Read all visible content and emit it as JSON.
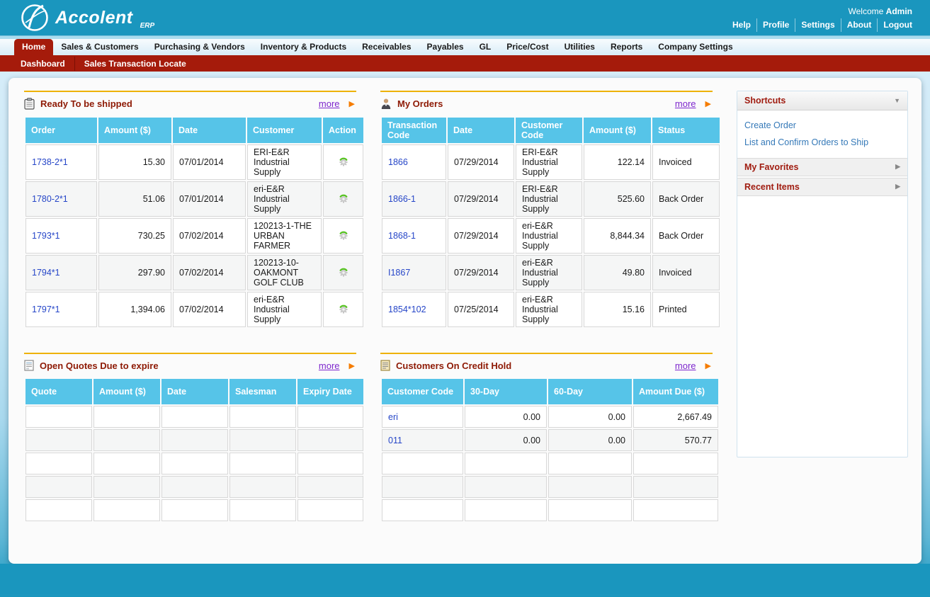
{
  "header": {
    "brand": "Accolent",
    "brand_suffix": "ERP",
    "welcome_prefix": "Welcome",
    "welcome_user": "Admin",
    "links": [
      "Help",
      "Profile",
      "Settings",
      "About",
      "Logout"
    ]
  },
  "nav": {
    "tabs": [
      {
        "label": "Home",
        "active": true
      },
      {
        "label": "Sales & Customers"
      },
      {
        "label": "Purchasing & Vendors"
      },
      {
        "label": "Inventory & Products"
      },
      {
        "label": "Receivables"
      },
      {
        "label": "Payables"
      },
      {
        "label": "GL"
      },
      {
        "label": "Price/Cost"
      },
      {
        "label": "Utilities"
      },
      {
        "label": "Reports"
      },
      {
        "label": "Company Settings"
      }
    ],
    "subnav": [
      "Dashboard",
      "Sales Transaction Locate"
    ]
  },
  "widgets": {
    "ready_to_ship": {
      "title": "Ready To be shipped",
      "more_label": "more",
      "columns": [
        "Order",
        "Amount ($)",
        "Date",
        "Customer",
        "Action"
      ],
      "rows": [
        {
          "order": "1738-2*1",
          "amount": "15.30",
          "date": "07/01/2014",
          "customer": "ERI-E&R Industrial Supply",
          "action": true
        },
        {
          "order": "1780-2*1",
          "amount": "51.06",
          "date": "07/01/2014",
          "customer": "eri-E&R Industrial Supply",
          "action": true
        },
        {
          "order": "1793*1",
          "amount": "730.25",
          "date": "07/02/2014",
          "customer": "120213-1-THE URBAN FARMER",
          "action": true
        },
        {
          "order": "1794*1",
          "amount": "297.90",
          "date": "07/02/2014",
          "customer": "120213-10-OAKMONT GOLF CLUB",
          "action": true
        },
        {
          "order": "1797*1",
          "amount": "1,394.06",
          "date": "07/02/2014",
          "customer": "eri-E&R Industrial Supply",
          "action": true
        }
      ]
    },
    "my_orders": {
      "title": "My Orders",
      "more_label": "more",
      "columns": [
        "Transaction Code",
        "Date",
        "Customer Code",
        "Amount ($)",
        "Status"
      ],
      "rows": [
        {
          "code": "1866",
          "date": "07/29/2014",
          "customer": "ERI-E&R Industrial Supply",
          "amount": "122.14",
          "status": "Invoiced"
        },
        {
          "code": "1866-1",
          "date": "07/29/2014",
          "customer": "ERI-E&R Industrial Supply",
          "amount": "525.60",
          "status": "Back Order"
        },
        {
          "code": "1868-1",
          "date": "07/29/2014",
          "customer": "eri-E&R Industrial Supply",
          "amount": "8,844.34",
          "status": "Back Order"
        },
        {
          "code": "I1867",
          "date": "07/29/2014",
          "customer": "eri-E&R Industrial Supply",
          "amount": "49.80",
          "status": "Invoiced"
        },
        {
          "code": "1854*102",
          "date": "07/25/2014",
          "customer": "eri-E&R Industrial Supply",
          "amount": "15.16",
          "status": "Printed"
        }
      ]
    },
    "open_quotes": {
      "title": "Open Quotes Due to expire",
      "more_label": "more",
      "columns": [
        "Quote",
        "Amount ($)",
        "Date",
        "Salesman",
        "Expiry Date"
      ],
      "rows": [
        {},
        {},
        {},
        {},
        {}
      ]
    },
    "credit_hold": {
      "title": "Customers On Credit Hold",
      "more_label": "more",
      "columns": [
        "Customer Code",
        "30-Day",
        "60-Day",
        "Amount Due ($)"
      ],
      "rows": [
        {
          "customer": "eri",
          "d30": "0.00",
          "d60": "0.00",
          "due": "2,667.49"
        },
        {
          "customer": "011",
          "d30": "0.00",
          "d60": "0.00",
          "due": "570.77"
        },
        {},
        {},
        {}
      ]
    }
  },
  "sidebar": {
    "shortcuts_label": "Shortcuts",
    "shortcut_links": [
      "Create Order",
      "List and Confirm Orders to Ship"
    ],
    "favorites_label": "My Favorites",
    "recent_label": "Recent Items"
  },
  "colors": {
    "header_teal": "#1a96be",
    "nav_red": "#a51b0b",
    "table_header_blue": "#56c4e8",
    "widget_gold_line": "#eeb200",
    "widget_title_red": "#8e1a05",
    "table_link_blue": "#2646c8",
    "more_link_purple": "#7d26cd",
    "more_arrow_orange": "#f57c00",
    "sidebar_link_blue": "#3579b8"
  }
}
